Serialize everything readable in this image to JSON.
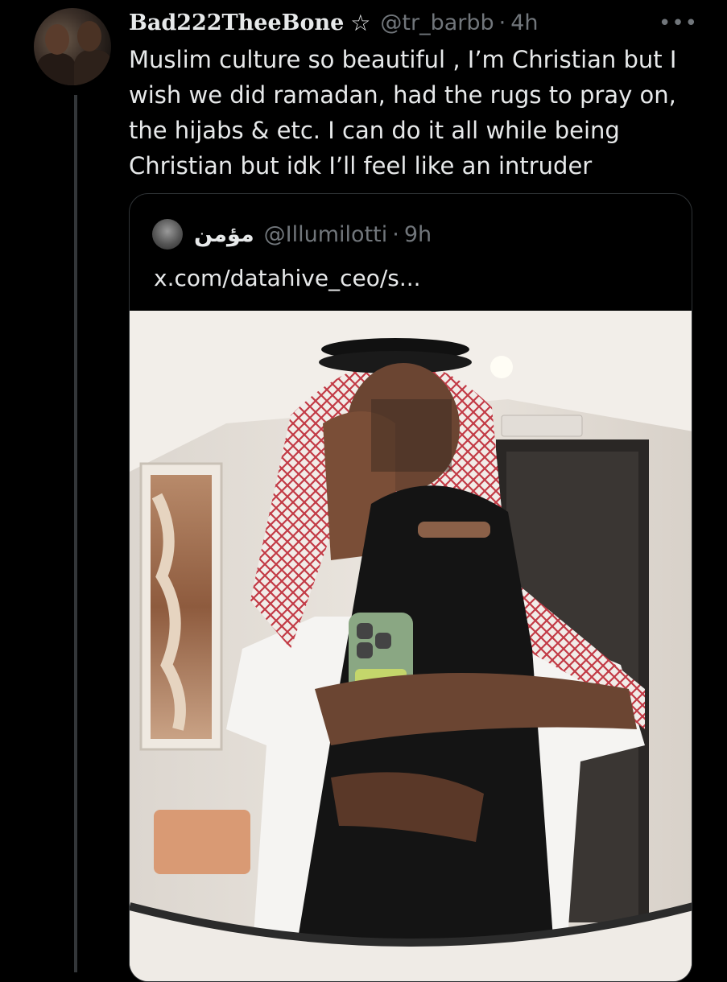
{
  "tweet": {
    "display_name": "Bad222TheeBone",
    "name_badge_icon": "star-outline-icon",
    "handle": "@tr_barbb",
    "separator": "·",
    "time": "4h",
    "more_icon": "more-horizontal-icon",
    "text": "Muslim culture so beautiful , I’m Christian but I wish we did ramadan, had the rugs to pray on, the hijabs & etc. I can do it all while being Christian but idk I’ll feel like an intruder"
  },
  "quote": {
    "display_name": "مؤمن",
    "handle": "@Illumilotti",
    "separator": "·",
    "time": "9h",
    "text": "x.com/datahive_ceo/s..."
  },
  "colors": {
    "background": "#000000",
    "text_primary": "#e7e9ea",
    "text_secondary": "#71767b",
    "border": "#2f3336"
  }
}
